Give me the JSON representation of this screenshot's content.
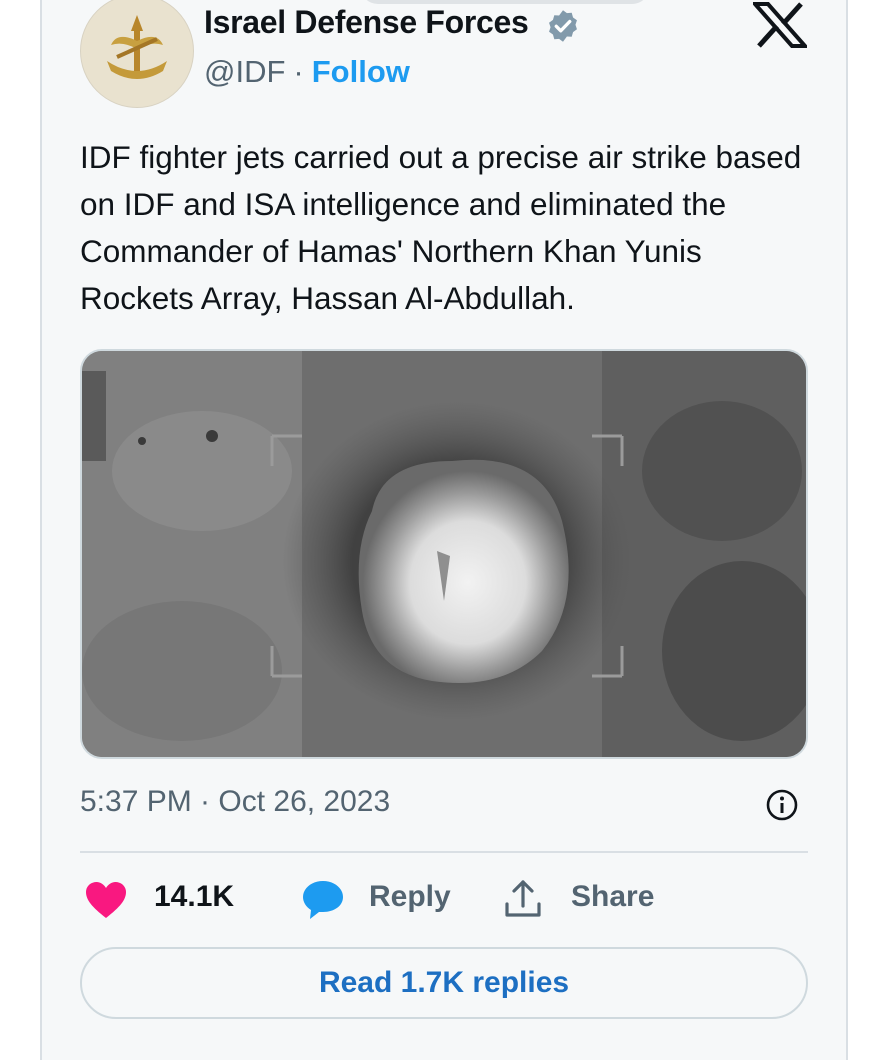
{
  "author": {
    "name": "Israel Defense Forces",
    "handle": "@IDF",
    "separator": "·",
    "follow_label": "Follow"
  },
  "post": {
    "text": "IDF fighter jets carried out a precise air strike based on IDF and ISA intelligence and eliminated the Commander of Hamas' Northern Khan Yunis Rockets Array, Hassan Al-Abdullah.",
    "timestamp": "5:37 PM · Oct 26, 2023"
  },
  "actions": {
    "likes": "14.1K",
    "reply_label": "Reply",
    "share_label": "Share",
    "read_replies_label": "Read 1.7K replies"
  },
  "colors": {
    "accent": "#1d9bf0",
    "heart": "#f91880",
    "muted": "#536471"
  },
  "icons": [
    "verified-badge-icon",
    "x-logo-icon",
    "info-icon",
    "heart-icon",
    "reply-bubble-icon",
    "share-icon"
  ]
}
